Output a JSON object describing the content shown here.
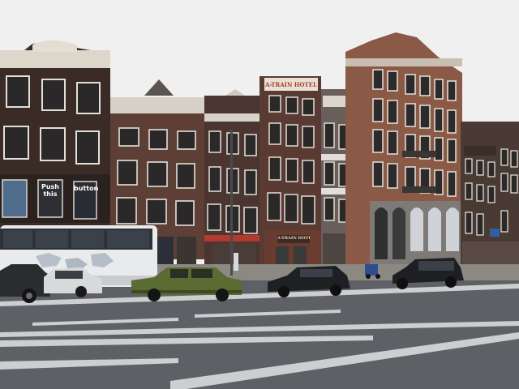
{
  "scene": {
    "description_hidden": false,
    "sky_color": "#f1f1f1",
    "road_color": "#5c5e63",
    "sidewalk_color": "#8a8780"
  },
  "signs": {
    "hotel_roof": "A-TRAIN HOTEL",
    "hotel_ground": "A-TRAIN HOTEL",
    "push_this": "Push this",
    "button": "button"
  },
  "colors": {
    "brick_dark": "#3b2a25",
    "brick_mid": "#5a3f36",
    "brick_red": "#7a4a3c",
    "stone": "#8f7f74",
    "mercedes_green": "#5a6b34",
    "bus_white": "#e9eaec",
    "window": "#2b2a2a",
    "window_frame": "#e6e3dc"
  }
}
